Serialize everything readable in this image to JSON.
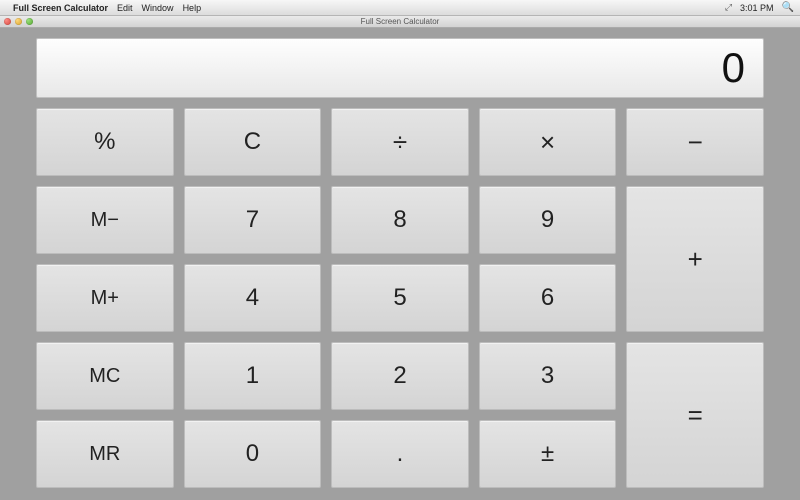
{
  "menubar": {
    "app_name": "Full Screen Calculator",
    "items": [
      "Edit",
      "Window",
      "Help"
    ],
    "clock": "3:01 PM"
  },
  "titlebar": {
    "title": "Full Screen Calculator"
  },
  "display": {
    "value": "0"
  },
  "keys": {
    "percent": "%",
    "clear": "C",
    "divide": "÷",
    "multiply": "×",
    "minus": "−",
    "m_minus": "M−",
    "seven": "7",
    "eight": "8",
    "nine": "9",
    "plus": "+",
    "m_plus": "M+",
    "four": "4",
    "five": "5",
    "six": "6",
    "m_clear": "MC",
    "one": "1",
    "two": "2",
    "three": "3",
    "equals": "=",
    "m_recall": "MR",
    "zero": "0",
    "decimal": ".",
    "plus_minus": "±"
  }
}
